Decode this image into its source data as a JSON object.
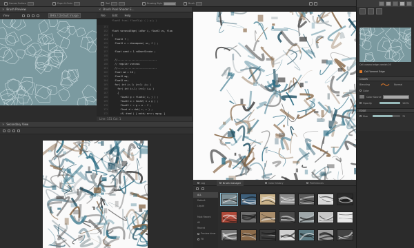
{
  "topbar": {
    "groups": [
      "Canvas Surface",
      "Paper & Grain",
      "Tool",
      "Drawing Style",
      "Brush"
    ]
  },
  "brush_preview": {
    "title": "Brush Preview",
    "view_label": "View",
    "mode_value": "BHG / Default Image",
    "voronoi_color": "#7b9aa0"
  },
  "code_editor": {
    "title": "Brush Pixel Shader E...",
    "menu": [
      "File",
      "Edit",
      "Help"
    ],
    "header_line": "float3 frac( float3(p) ( ) p(; )",
    "line_numbers": [
      "151",
      "152",
      "153",
      "154",
      "155",
      "156",
      "157",
      "158",
      "159",
      "160",
      "161",
      "162",
      "163",
      "164",
      "165",
      "166",
      "167",
      "168",
      "169",
      "170",
      "171",
      "172",
      "173",
      "174"
    ],
    "lines": [
      "",
      "float voronoiEdge( idVar i, float2 uv, floa",
      "{",
      "  float2 f ;",
      "  float2 n = decompose( uv, f ) ;",
      "",
      "  float seed = 1.rdUserStroke ;",
      "",
      "  //----------------------------",
      "  // regular voronoi",
      "  //----------------------------",
      "  float md = 10 ;",
      "  float2 mg;",
      "  float2 mr;",
      "  for( int j=-1; j<=1; j++ )",
      "    for( int i=-1; i<=1; i++ )",
      "    {",
      "      float2 g = float2( i, j ) ;",
      "      float2 o = hash2( n + g ) ;",
      "      float2 r = g + o - f ;",
      "      float d = dot( r, r ) ;",
      "      if( d<md ) { md=d; mr=r; mg=g; }",
      "    }",
      "  return md ;"
    ],
    "status": "Line: 151   Col: 1"
  },
  "secondary_view": {
    "title": "Secondary View"
  },
  "right_panel": {
    "thumb_label": "Cell voronoi edge varnish 05",
    "brush_name": "Cell Voronoi Edge",
    "color_header": "COLOR",
    "blending_label": "Blending",
    "blending_value": "Normal",
    "color_label": "Color",
    "source_label": "Color Source",
    "opacity_label": "Opacity",
    "opacity_percent": 100,
    "opacity_text": "100%",
    "edge_header": "EDGE",
    "size_label": "Size",
    "size_fraction": 0.72,
    "size_text": "72",
    "accent": "#e07a2a"
  },
  "brush_manager": {
    "tabs": [
      "Log",
      "Brush manager",
      "Color history",
      "Preferences"
    ],
    "active_tab": "Brush manager",
    "categories": [
      "ALL",
      "Default",
      "Liquid",
      "",
      "Most Recent",
      "All",
      "Recent"
    ],
    "option_labels": [
      "Preview draw",
      "Fill"
    ]
  },
  "colors": {
    "teal": "#2f6f86",
    "brown": "#8a6a4a",
    "gray": "#6b6b6b",
    "panel": "#2e2e2e"
  }
}
